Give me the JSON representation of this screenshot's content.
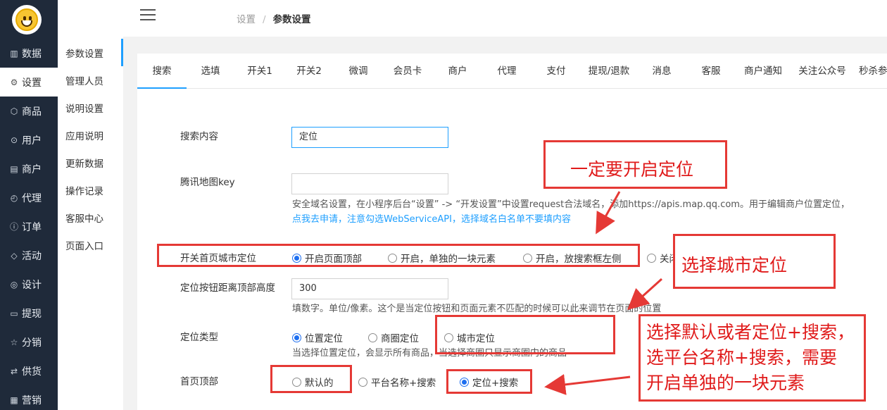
{
  "nav": {
    "items": [
      {
        "icon": "chart-icon",
        "glyph": "▥",
        "label": "数据"
      },
      {
        "icon": "gear-icon",
        "glyph": "⚙",
        "label": "设置"
      },
      {
        "icon": "box-icon",
        "glyph": "⬡",
        "label": "商品"
      },
      {
        "icon": "user-icon",
        "glyph": "⊙",
        "label": "用户"
      },
      {
        "icon": "shop-icon",
        "glyph": "▤",
        "label": "商户"
      },
      {
        "icon": "agent-icon",
        "glyph": "◴",
        "label": "代理"
      },
      {
        "icon": "info-icon",
        "glyph": "ⓘ",
        "label": "订单"
      },
      {
        "icon": "tag-icon",
        "glyph": "◇",
        "label": "活动"
      },
      {
        "icon": "design-icon",
        "glyph": "◎",
        "label": "设计"
      },
      {
        "icon": "card-icon",
        "glyph": "▭",
        "label": "提现"
      },
      {
        "icon": "star-icon",
        "glyph": "☆",
        "label": "分销"
      },
      {
        "icon": "swap-icon",
        "glyph": "⇄",
        "label": "供货"
      },
      {
        "icon": "sale-icon",
        "glyph": "▦",
        "label": "营销"
      }
    ]
  },
  "subnav": {
    "items": [
      "参数设置",
      "管理人员",
      "说明设置",
      "应用说明",
      "更新数据",
      "操作记录",
      "客服中心",
      "页面入口"
    ]
  },
  "breadcrumb": {
    "parent": "设置",
    "sep": "/",
    "current": "参数设置"
  },
  "tabs": [
    "搜索",
    "选填",
    "开关1",
    "开关2",
    "微调",
    "会员卡",
    "商户",
    "代理",
    "支付",
    "提现/退款",
    "消息",
    "客服",
    "商户通知",
    "关注公众号",
    "秒杀参"
  ],
  "form": {
    "search_label": "搜索内容",
    "search_value": "定位",
    "map_key_label": "腾讯地图key",
    "map_key_value": "",
    "map_hint1": "安全域名设置，在小程序后台“设置” -> “开发设置”中设置request合法域名，添加https://apis.map.qq.com。用于编辑商户位置定位，",
    "map_hint2": "点我去申请，注意勾选WebServiceAPI，选择域名白名单不要填内容",
    "city_label": "开关首页城市定位",
    "city_options": [
      "开启页面顶部",
      "开启，单独的一块元素",
      "开启，放搜索框左侧",
      "关闭"
    ],
    "height_label": "定位按钮距离顶部高度",
    "height_value": "300",
    "height_hint": "填数字。单位/像素。这个是当定位按钮和页面元素不匹配的时候可以此来调节在页面的位置",
    "loc_type_label": "定位类型",
    "loc_type_options": [
      "位置定位",
      "商圈定位",
      "城市定位"
    ],
    "loc_type_hint": "当选择位置定位，会显示所有商品，当选择商圈只显示商圈内的商品",
    "top_label": "首页顶部",
    "top_options": [
      "默认的",
      "平台名称+搜索",
      "定位+搜索"
    ]
  },
  "annotations": {
    "note1": "一定要开启定位",
    "note2": "选择城市定位",
    "note3_line1": "选择默认或者定位+搜索，",
    "note3_line2": "选平台名称+搜索，需要",
    "note3_line3": "开启单独的一块元素"
  },
  "colors": {
    "nav_bg": "#1f2a3a",
    "accent": "#1e9fff",
    "annotation": "#e53935"
  }
}
